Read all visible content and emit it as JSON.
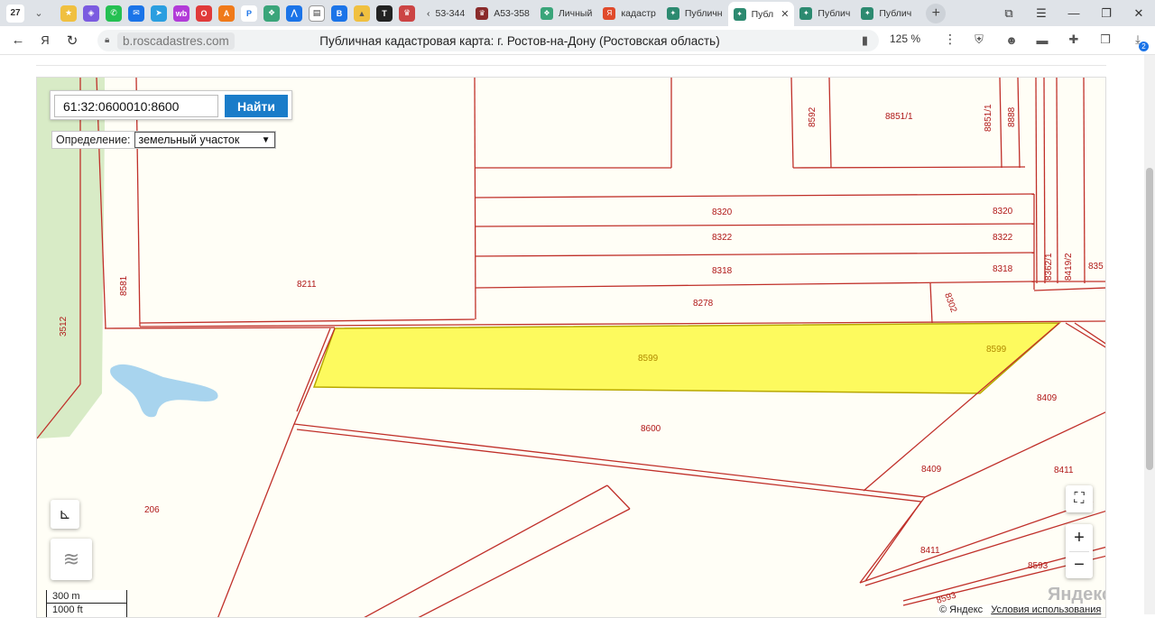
{
  "browser": {
    "tab_count": "27",
    "tabs": [
      {
        "label": "53-344",
        "color": "#6d6d6d"
      },
      {
        "label": "А53-358",
        "color": "#8a2b2b"
      },
      {
        "label": "Личный",
        "color": "#3aa57a"
      },
      {
        "label": "кадастр",
        "color": "#e04a2b"
      },
      {
        "label": "Публичн",
        "color": "#2c8a70"
      },
      {
        "label": "Публ",
        "color": "#2c8a70",
        "active": true
      },
      {
        "label": "Публич",
        "color": "#2c8a70"
      },
      {
        "label": "Публич",
        "color": "#2c8a70"
      }
    ],
    "domain": "b.roscadastres.com",
    "page_title": "Публичная кадастровая карта: г. Ростов-на-Дону (Ростовская область)",
    "zoom": "125 %",
    "badge": "2"
  },
  "search": {
    "value": "61:32:0600010:8600",
    "button_label": "Найти"
  },
  "definition": {
    "label": "Определение:",
    "selected": "земельный участок"
  },
  "map_labels": {
    "p8592": "8592",
    "p8851_1": "8851/1",
    "p8851_1v": "8851/1",
    "p8888": "8888",
    "p8320a": "8320",
    "p8320b": "8320",
    "p8322a": "8322",
    "p8322b": "8322",
    "p8318a": "8318",
    "p8318b": "8318",
    "p8362_1": "8362/1",
    "p8419_2": "8419/2",
    "p835": "835",
    "p8278": "8278",
    "p8302": "8302",
    "p8211": "8211",
    "p8581": "8581",
    "p3512": "3512",
    "p8599a": "8599",
    "p8599b": "8599",
    "p8409a": "8409",
    "p8409b": "8409",
    "p8600": "8600",
    "p8411a": "8411",
    "p8411b": "8411",
    "p206": "206",
    "p8593a": "8593",
    "p8593b": "8593"
  },
  "scale": {
    "metric": "300 m",
    "imperial": "1000 ft"
  },
  "attribution": {
    "copyright": "© Яндекс",
    "terms": "Условия использования",
    "logo": "Яндекс"
  },
  "colors": {
    "parcel_border": "#c0302a",
    "selected_fill": "#fdfa5e",
    "water": "#a8d4ee",
    "greenery": "#d8ebc6",
    "button_blue": "#1a7cc9"
  }
}
